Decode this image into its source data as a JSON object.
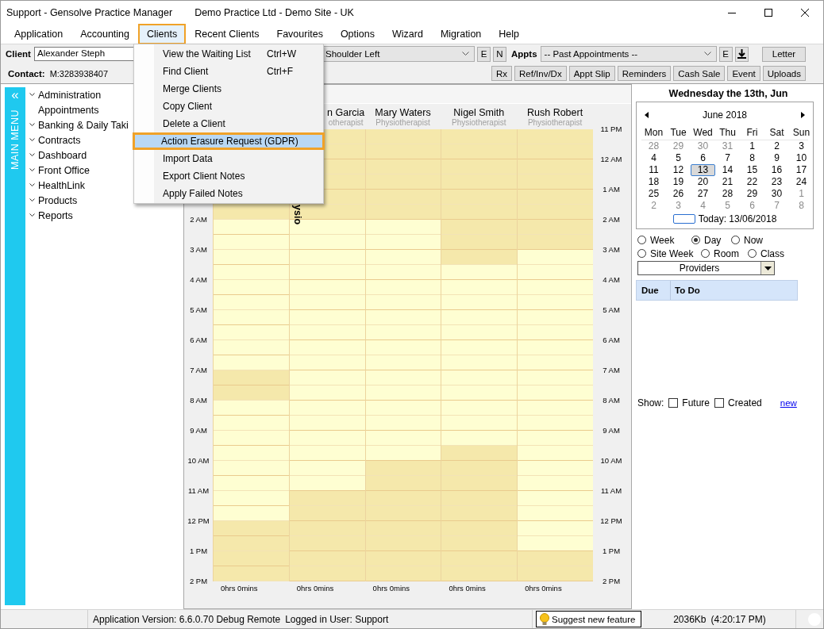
{
  "window": {
    "title": "Support - Gensolve Practice Manager",
    "subtitle": "Demo Practice Ltd - Demo Site - UK"
  },
  "menu_bar": [
    {
      "label": "Application",
      "selected": false
    },
    {
      "label": "Accounting",
      "selected": false
    },
    {
      "label": "Clients",
      "selected": true
    },
    {
      "label": "Recent Clients",
      "selected": false
    },
    {
      "label": "Favourites",
      "selected": false
    },
    {
      "label": "Options",
      "selected": false
    },
    {
      "label": "Wizard",
      "selected": false
    },
    {
      "label": "Migration",
      "selected": false
    },
    {
      "label": "Help",
      "selected": false
    }
  ],
  "clients_menu": [
    {
      "label": "View the Waiting List",
      "shortcut": "Ctrl+W",
      "selected": false
    },
    {
      "label": "Find Client",
      "shortcut": "Ctrl+F",
      "selected": false
    },
    {
      "label": "Merge Clients",
      "selected": false
    },
    {
      "label": "Copy Client",
      "selected": false
    },
    {
      "label": "Delete a Client",
      "selected": false
    },
    {
      "label": "Action Erasure Request (GDPR)",
      "selected": true
    },
    {
      "label": "Import Data",
      "selected": false
    },
    {
      "label": "Export Client Notes",
      "selected": false
    },
    {
      "label": "Apply Failed Notes",
      "selected": false
    }
  ],
  "toolbar": {
    "client_label": "Client",
    "client_value": "Alexander Steph",
    "condition_value": "Shoulder Left",
    "condition_buttons": [
      "E",
      "N"
    ],
    "appts_label": "Appts",
    "appts_value": "-- Past Appointments --",
    "appts_buttons": [
      "E"
    ],
    "letter_button": "Letter",
    "contact_label": "Contact:",
    "contact_value": "M:3283938407",
    "action_buttons": [
      "Rx",
      "Ref/Inv/Dx",
      "Appt Slip",
      "Reminders",
      "Cash Sale",
      "Event",
      "Uploads"
    ]
  },
  "main_menu": {
    "collapse": "«",
    "title": "MAIN MENU",
    "items": [
      {
        "label": "Administration",
        "expandable": true
      },
      {
        "label": "Appointments",
        "expandable": false
      },
      {
        "label": "Banking & Daily Taki",
        "expandable": true
      },
      {
        "label": "Contracts",
        "expandable": true
      },
      {
        "label": "Dashboard",
        "expandable": true
      },
      {
        "label": "Front Office",
        "expandable": true
      },
      {
        "label": "HealthLink",
        "expandable": true
      },
      {
        "label": "Products",
        "expandable": true
      },
      {
        "label": "Reports",
        "expandable": true
      }
    ]
  },
  "schedule": {
    "left_times": [
      "2 AM",
      "3 AM",
      "4 AM",
      "5 AM",
      "6 AM",
      "7 AM",
      "8 AM",
      "9 AM",
      "10 AM",
      "11 AM",
      "12 PM",
      "1 PM",
      "2 PM"
    ],
    "right_times": [
      "11 PM",
      "12 AM",
      "1 AM",
      "2 AM",
      "3 AM",
      "4 AM",
      "5 AM",
      "6 AM",
      "7 AM",
      "8 AM",
      "9 AM",
      "10 AM",
      "11 AM",
      "12 PM",
      "1 PM",
      "2 PM"
    ],
    "providers": [
      {
        "total": "0hrs 0mins",
        "slots": [
          true,
          false,
          false,
          false,
          false,
          false,
          false,
          false,
          false,
          false,
          false,
          true,
          true,
          false,
          false,
          false,
          false,
          false,
          false,
          false,
          false,
          true,
          true,
          true,
          true
        ]
      },
      {
        "name": "n Garcia",
        "role": "otherapist",
        "appointment": "ysio",
        "total": "0hrs 0mins",
        "slots": [
          true,
          true,
          true,
          true,
          true,
          true,
          false,
          false,
          false,
          false,
          false,
          false,
          false,
          false,
          false,
          false,
          false,
          false,
          false,
          false,
          false,
          false,
          false,
          false,
          true,
          true,
          true,
          true,
          true,
          true
        ]
      },
      {
        "name": "Mary Waters",
        "role": "Physiotherapist",
        "total": "0hrs 0mins",
        "slots": [
          true,
          true,
          true,
          true,
          true,
          true,
          false,
          false,
          false,
          false,
          false,
          false,
          false,
          false,
          false,
          false,
          false,
          false,
          false,
          false,
          false,
          false,
          true,
          true,
          true,
          true,
          true,
          true,
          true,
          true
        ]
      },
      {
        "name": "Nigel Smith",
        "role": "Physiotherapist",
        "total": "0hrs 0mins",
        "slots": [
          true,
          true,
          true,
          true,
          true,
          true,
          true,
          true,
          true,
          false,
          false,
          false,
          false,
          false,
          false,
          false,
          false,
          false,
          false,
          false,
          false,
          true,
          true,
          true,
          true,
          true,
          true,
          true,
          true,
          true
        ]
      },
      {
        "name": "Rush Robert",
        "role": "Physiotherapist",
        "total": "0hrs 0mins",
        "slots": [
          true,
          true,
          true,
          true,
          true,
          true,
          true,
          true,
          false,
          false,
          false,
          false,
          false,
          false,
          false,
          false,
          false,
          false,
          false,
          false,
          false,
          false,
          false,
          false,
          false,
          false,
          false,
          false,
          true,
          true
        ]
      }
    ]
  },
  "calendar": {
    "heading": "Wednesday the 13th, Jun",
    "month": "June 2018",
    "weekdays": [
      "Mon",
      "Tue",
      "Wed",
      "Thu",
      "Fri",
      "Sat",
      "Sun"
    ],
    "days": [
      {
        "d": "28",
        "other": true,
        "selected": false
      },
      {
        "d": "29",
        "other": true,
        "selected": false
      },
      {
        "d": "30",
        "other": true,
        "selected": false
      },
      {
        "d": "31",
        "other": true,
        "selected": false
      },
      {
        "d": "1",
        "other": false,
        "selected": false
      },
      {
        "d": "2",
        "other": false,
        "selected": false
      },
      {
        "d": "3",
        "other": false,
        "selected": false
      },
      {
        "d": "4",
        "other": false,
        "selected": false
      },
      {
        "d": "5",
        "other": false,
        "selected": false
      },
      {
        "d": "6",
        "other": false,
        "selected": false
      },
      {
        "d": "7",
        "other": false,
        "selected": false
      },
      {
        "d": "8",
        "other": false,
        "selected": false
      },
      {
        "d": "9",
        "other": false,
        "selected": false
      },
      {
        "d": "10",
        "other": false,
        "selected": false
      },
      {
        "d": "11",
        "other": false,
        "selected": false
      },
      {
        "d": "12",
        "other": false,
        "selected": false
      },
      {
        "d": "13",
        "other": false,
        "selected": true
      },
      {
        "d": "14",
        "other": false,
        "selected": false
      },
      {
        "d": "15",
        "other": false,
        "selected": false
      },
      {
        "d": "16",
        "other": false,
        "selected": false
      },
      {
        "d": "17",
        "other": false,
        "selected": false
      },
      {
        "d": "18",
        "other": false,
        "selected": false
      },
      {
        "d": "19",
        "other": false,
        "selected": false
      },
      {
        "d": "20",
        "other": false,
        "selected": false
      },
      {
        "d": "21",
        "other": false,
        "selected": false
      },
      {
        "d": "22",
        "other": false,
        "selected": false
      },
      {
        "d": "23",
        "other": false,
        "selected": false
      },
      {
        "d": "24",
        "other": false,
        "selected": false
      },
      {
        "d": "25",
        "other": false,
        "selected": false
      },
      {
        "d": "26",
        "other": false,
        "selected": false
      },
      {
        "d": "27",
        "other": false,
        "selected": false
      },
      {
        "d": "28",
        "other": false,
        "selected": false
      },
      {
        "d": "29",
        "other": false,
        "selected": false
      },
      {
        "d": "30",
        "other": false,
        "selected": false
      },
      {
        "d": "1",
        "other": true,
        "selected": false
      },
      {
        "d": "2",
        "other": true,
        "selected": false
      },
      {
        "d": "3",
        "other": true,
        "selected": false
      },
      {
        "d": "4",
        "other": true,
        "selected": false
      },
      {
        "d": "5",
        "other": true,
        "selected": false
      },
      {
        "d": "6",
        "other": true,
        "selected": false
      },
      {
        "d": "7",
        "other": true,
        "selected": false
      },
      {
        "d": "8",
        "other": true,
        "selected": false
      }
    ],
    "today": "Today: 13/06/2018"
  },
  "view_options": [
    {
      "label": "Week",
      "selected": false
    },
    {
      "label": "Day",
      "selected": true
    },
    {
      "label": "Now",
      "selected": false
    },
    {
      "label": "Site Week",
      "selected": false
    },
    {
      "label": "Room",
      "selected": false
    },
    {
      "label": "Class",
      "selected": false
    }
  ],
  "provider_select": "Providers",
  "todo": {
    "columns": [
      "Due",
      "To Do"
    ]
  },
  "show": {
    "label": "Show:",
    "options": [
      {
        "label": "Future",
        "checked": false
      },
      {
        "label": "Created",
        "checked": false
      }
    ],
    "link": "new"
  },
  "status_bar": {
    "version": "Application Version: 6.6.0.70 Debug Remote",
    "user": "Logged in User: Support",
    "suggest_button": "Suggest new feature",
    "memory": "2036Kb",
    "time": "(4:20:17 PM)"
  }
}
